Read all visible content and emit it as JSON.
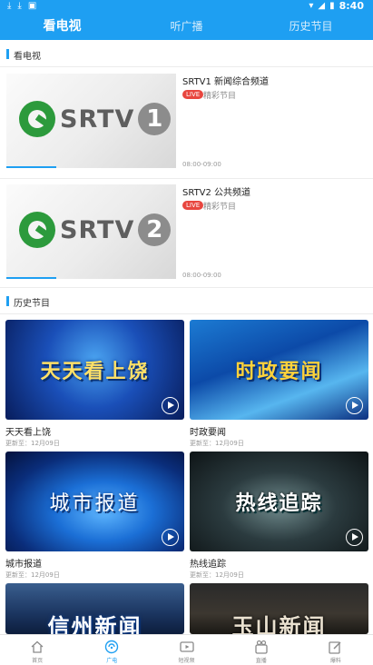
{
  "status": {
    "time": "8:40"
  },
  "top_tabs": [
    {
      "label": "看电视",
      "active": true
    },
    {
      "label": "听广播",
      "active": false
    },
    {
      "label": "历史节目",
      "active": false
    }
  ],
  "tv_section": {
    "title": "看电视"
  },
  "channels": [
    {
      "name": "SRTV1 新闻综合频道",
      "live_badge": "LIVE",
      "program": "精彩节目",
      "time": "08:00-09:00",
      "logo_text": "SRTV",
      "logo_num": "1"
    },
    {
      "name": "SRTV2 公共频道",
      "live_badge": "LIVE",
      "program": "精彩节目",
      "time": "08:00-09:00",
      "logo_text": "SRTV",
      "logo_num": "2"
    }
  ],
  "history_section": {
    "title": "历史节目"
  },
  "programs": [
    {
      "title": "天天看上饶",
      "updated": "更新至：12月09日",
      "caption": "天天看上饶"
    },
    {
      "title": "时政要闻",
      "updated": "更新至：12月09日",
      "caption": "时政要闻"
    },
    {
      "title": "城市报道",
      "updated": "更新至：12月09日",
      "caption": "城市报道"
    },
    {
      "title": "热线追踪",
      "updated": "更新至：12月09日",
      "caption": "热线追踪"
    },
    {
      "title": "",
      "updated": "",
      "caption": "信州新闻"
    },
    {
      "title": "",
      "updated": "",
      "caption": "玉山新闻"
    }
  ],
  "bottom_nav": [
    {
      "label": "首页",
      "icon": "home-icon",
      "active": false
    },
    {
      "label": "广电",
      "icon": "broadcast-icon",
      "active": true
    },
    {
      "label": "短视频",
      "icon": "video-icon",
      "active": false
    },
    {
      "label": "直播",
      "icon": "live-tv-icon",
      "active": false
    },
    {
      "label": "爆料",
      "icon": "edit-icon",
      "active": false
    }
  ],
  "colors": {
    "accent": "#1e9ff2",
    "live": "#e8463f",
    "logo_green": "#2c9a3c"
  }
}
